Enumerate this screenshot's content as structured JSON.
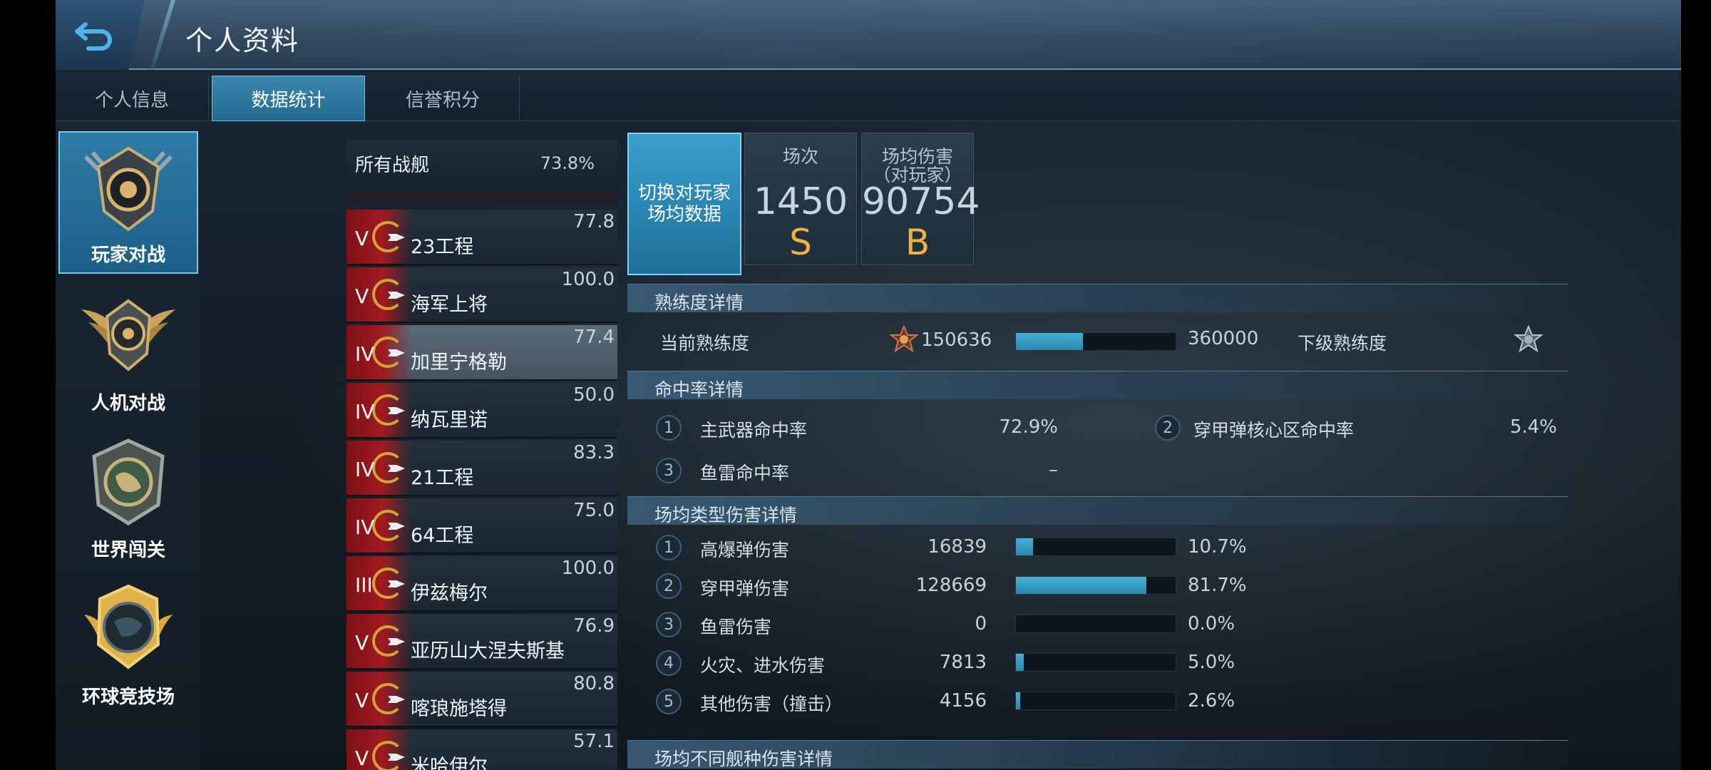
{
  "header": {
    "title": "个人资料"
  },
  "tabs": [
    {
      "label": "个人信息"
    },
    {
      "label": "数据统计"
    },
    {
      "label": "信誉积分"
    }
  ],
  "modes": [
    {
      "label": "玩家对战",
      "icon": "pvp-emblem-icon"
    },
    {
      "label": "人机对战",
      "icon": "pve-emblem-icon"
    },
    {
      "label": "世界闯关",
      "icon": "world-emblem-icon"
    },
    {
      "label": "环球竞技场",
      "icon": "arena-emblem-icon"
    }
  ],
  "ship_list": {
    "header_name": "所有战舰",
    "header_pct": "73.8%",
    "rows": [
      {
        "tier": "V",
        "name": "23工程",
        "value": "77.8"
      },
      {
        "tier": "V",
        "name": "海军上将",
        "value": "100.0"
      },
      {
        "tier": "IV",
        "name": "加里宁格勒",
        "value": "77.4",
        "selected": true
      },
      {
        "tier": "IV",
        "name": "纳瓦里诺",
        "value": "50.0"
      },
      {
        "tier": "IV",
        "name": "21工程",
        "value": "83.3"
      },
      {
        "tier": "IV",
        "name": "64工程",
        "value": "75.0"
      },
      {
        "tier": "III",
        "name": "伊兹梅尔",
        "value": "100.0"
      },
      {
        "tier": "V",
        "name": "亚历山大涅夫斯基",
        "value": "76.9"
      },
      {
        "tier": "V",
        "name": "喀琅施塔得",
        "value": "80.8"
      },
      {
        "tier": "V",
        "name": "米哈伊尔",
        "value": "57.1"
      }
    ]
  },
  "summary": {
    "switch_label": "切换对玩家场均数据",
    "battles": {
      "label": "场次",
      "value": "1450",
      "grade": "S"
    },
    "avg_damage": {
      "label": "场均伤害\n（对玩家）",
      "value": "90754",
      "grade": "B"
    }
  },
  "proficiency": {
    "section_title": "熟练度详情",
    "current_label": "当前熟练度",
    "current_value": "150636",
    "next_value": "360000",
    "next_label": "下级熟练度",
    "progress": 0.418
  },
  "hit_rate": {
    "section_title": "命中率详情",
    "items": [
      {
        "index": "1",
        "label": "主武器命中率",
        "value": "72.9%"
      },
      {
        "index": "2",
        "label": "穿甲弹核心区命中率",
        "value": "5.4%"
      },
      {
        "index": "3",
        "label": "鱼雷命中率",
        "value": "–"
      }
    ]
  },
  "damage_types": {
    "section_title": "场均类型伤害详情",
    "items": [
      {
        "index": "1",
        "label": "高爆弹伤害",
        "value": "16839",
        "pct": "10.7%",
        "fraction": 0.107
      },
      {
        "index": "2",
        "label": "穿甲弹伤害",
        "value": "128669",
        "pct": "81.7%",
        "fraction": 0.817
      },
      {
        "index": "3",
        "label": "鱼雷伤害",
        "value": "0",
        "pct": "0.0%",
        "fraction": 0.0
      },
      {
        "index": "4",
        "label": "火灾、进水伤害",
        "value": "7813",
        "pct": "5.0%",
        "fraction": 0.05
      },
      {
        "index": "5",
        "label": "其他伤害（撞击）",
        "value": "4156",
        "pct": "2.6%",
        "fraction": 0.026
      }
    ]
  },
  "ship_type_damage": {
    "section_title": "场均不同舰种伤害详情"
  },
  "colors": {
    "accent": "#3a9fce",
    "grade": "#f2b13a",
    "flag_red": "#a11a20"
  }
}
